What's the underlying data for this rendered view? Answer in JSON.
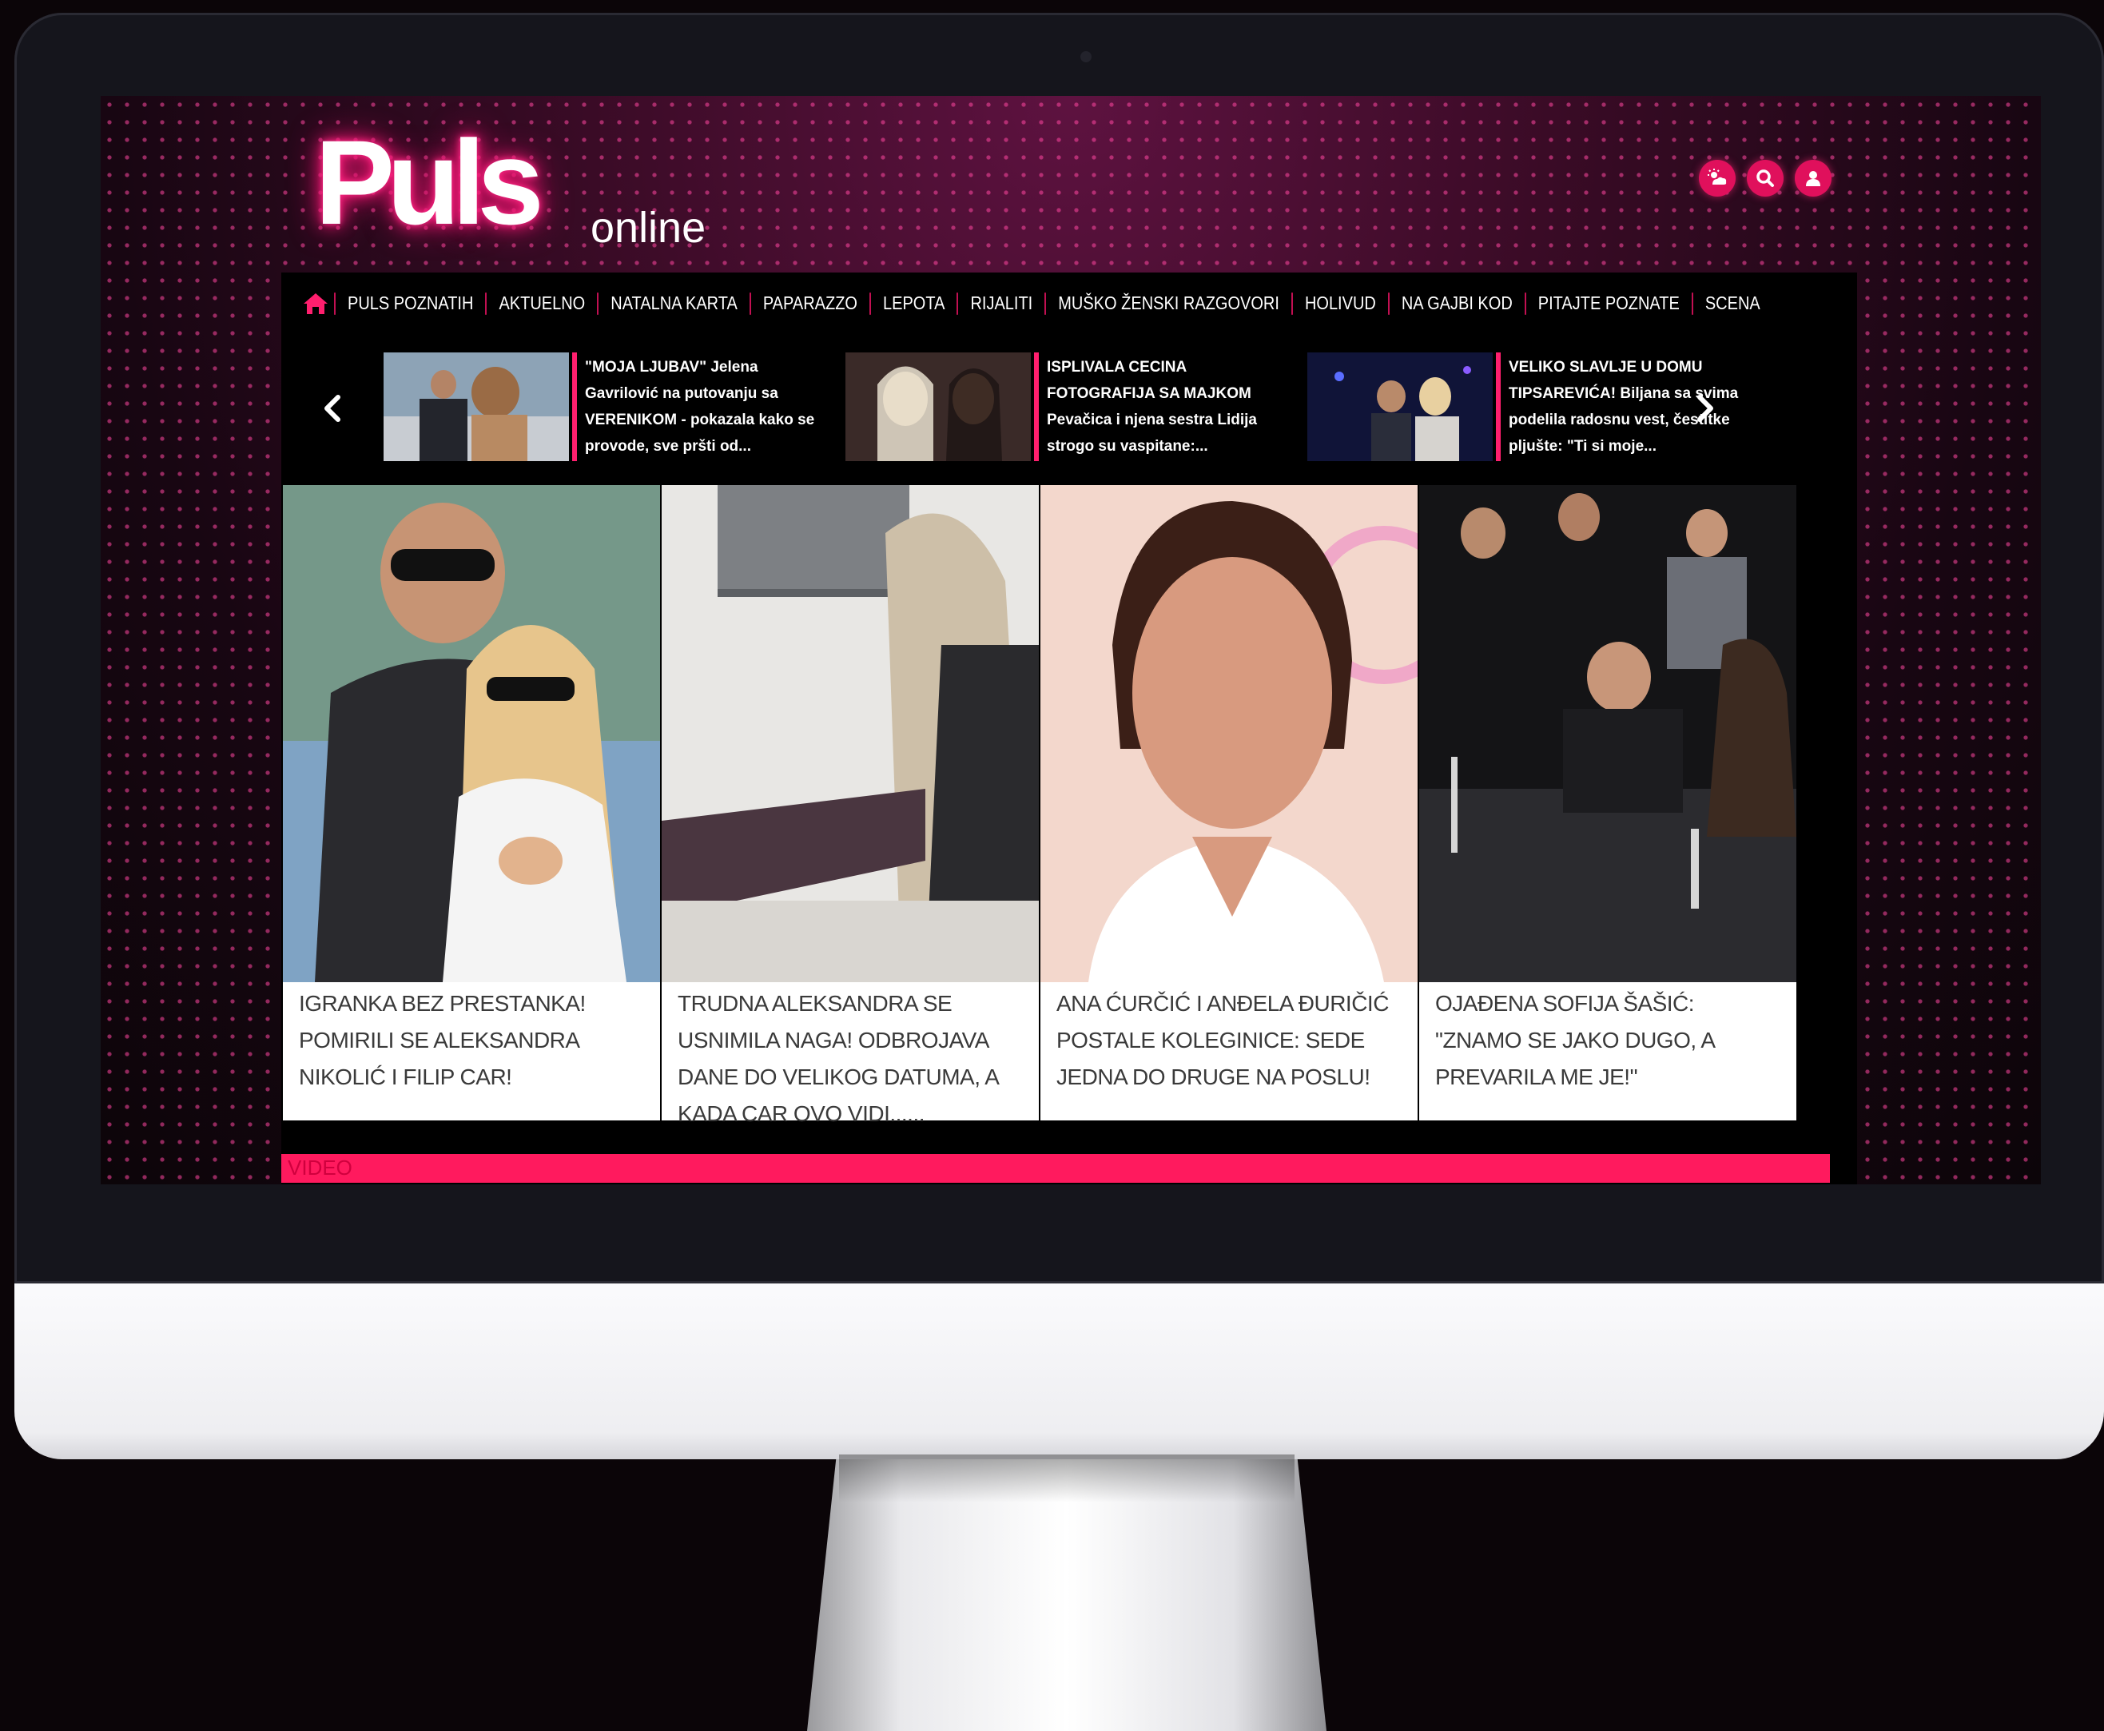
{
  "brand": {
    "logo_main": "Puls",
    "logo_sub": "online",
    "accent": "#ff1a5e",
    "dark_bg": "#000000"
  },
  "header_icons": [
    "weather-icon",
    "search-icon",
    "user-icon"
  ],
  "nav": {
    "home_icon": "home-icon",
    "items": [
      "PULS POZNATIH",
      "AKTUELNO",
      "NATALNA KARTA",
      "PAPARAZZO",
      "LEPOTA",
      "RIJALITI",
      "MUŠKO ŽENSKI RAZGOVORI",
      "HOLIVUD",
      "NA GAJBI KOD",
      "PITAJTE POZNATE",
      "SCENA"
    ]
  },
  "ticker": {
    "items": [
      {
        "text": "\"MOJA LJUBAV\" Jelena Gavrilović na putovanju sa VERENIKOM - pokazala kako se provode, sve pršti od..."
      },
      {
        "text": "ISPLIVALA CECINA FOTOGRAFIJA SA MAJKOM Pevačica i njena sestra Lidija strogo su vaspitane:..."
      },
      {
        "text": "VELIKO SLAVLJE U DOMU TIPSAREVIĆA! Biljana sa svima podelila radosnu vest, čestitke pljušte: \"Ti si moje..."
      }
    ]
  },
  "cards": [
    {
      "title": "IGRANKA BEZ PRESTANKA! POMIRILI SE ALEKSANDRA NIKOLIĆ I FILIP CAR!"
    },
    {
      "title": "TRUDNA ALEKSANDRA SE USNIMILA NAGA! ODBROJAVA DANE DO VELIKOG DATUMA, A KADA CAR OVO VIDI......"
    },
    {
      "title": "ANA ĆURČIĆ I ANĐELA ĐURIČIĆ POSTALE KOLEGINICE: SEDE JEDNA DO DRUGE NA POSLU!"
    },
    {
      "title": "OJAĐENA SOFIJA ŠAŠIĆ: \"ZNAMO SE JAKO DUGO, A PREVARILA ME JE!\""
    }
  ],
  "section_label": "VIDEO"
}
